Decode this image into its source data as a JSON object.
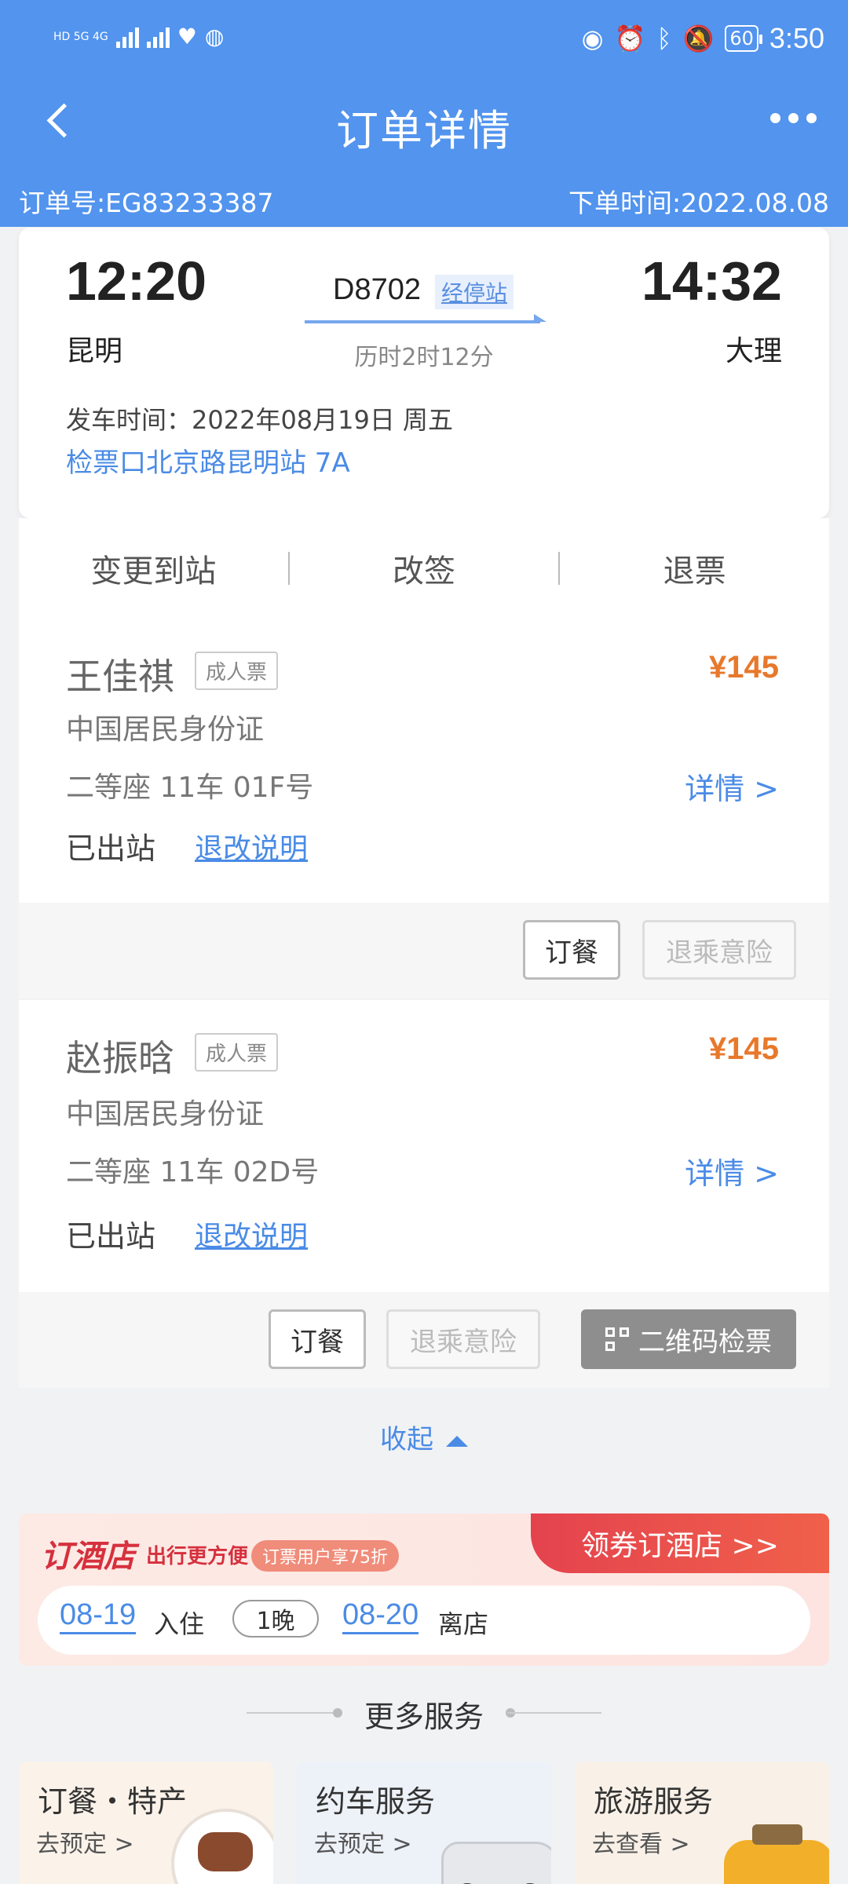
{
  "status_bar": {
    "network_left": "HD 5G 4G",
    "time": "3:50",
    "battery": "60"
  },
  "header": {
    "title": "订单详情"
  },
  "order": {
    "number_label": "订单号:EG83233387",
    "time_label": "下单时间:2022.08.08"
  },
  "train": {
    "depart_time": "12:20",
    "depart_station": "昆明",
    "arrive_time": "14:32",
    "arrive_station": "大理",
    "train_no": "D8702",
    "stops_link": "经停站",
    "duration": "历时2时12分",
    "depart_date": "发车时间：2022年08月19日 周五",
    "gate": "检票口北京路昆明站 7A"
  },
  "actions": {
    "change_station": "变更到站",
    "reschedule": "改签",
    "refund": "退票"
  },
  "passengers": [
    {
      "name": "王佳祺",
      "ticket_type": "成人票",
      "price": "¥145",
      "id_type": "中国居民身份证",
      "seat": "二等座 11车 01F号",
      "detail": "详情 >",
      "status": "已出站",
      "rules": "退改说明",
      "btn_meal": "订餐",
      "btn_insurance": "退乘意险"
    },
    {
      "name": "赵振晗",
      "ticket_type": "成人票",
      "price": "¥145",
      "id_type": "中国居民身份证",
      "seat": "二等座 11车 02D号",
      "detail": "详情 >",
      "status": "已出站",
      "rules": "退改说明",
      "btn_meal": "订餐",
      "btn_insurance": "退乘意险",
      "btn_qr": "二维码检票"
    }
  ],
  "collapse": "收起",
  "hotel": {
    "logo": "订酒店",
    "tagline": "出行更方便",
    "discount": "订票用户享75折",
    "cta": "领券订酒店 >>",
    "checkin_date": "08-19",
    "checkin_label": "入住",
    "nights": "1晚",
    "checkout_date": "08-20",
    "checkout_label": "离店"
  },
  "more_services": {
    "title": "更多服务",
    "items": [
      {
        "title": "订餐・特产",
        "sub": "去预定 >"
      },
      {
        "title": "约车服务",
        "sub": "去预定 >"
      },
      {
        "title": "旅游服务",
        "sub": "去查看 >"
      }
    ]
  },
  "colors": {
    "primary": "#5294ee",
    "link": "#4a8be6",
    "price": "#e8782b",
    "hotel_red": "#d6303d"
  }
}
